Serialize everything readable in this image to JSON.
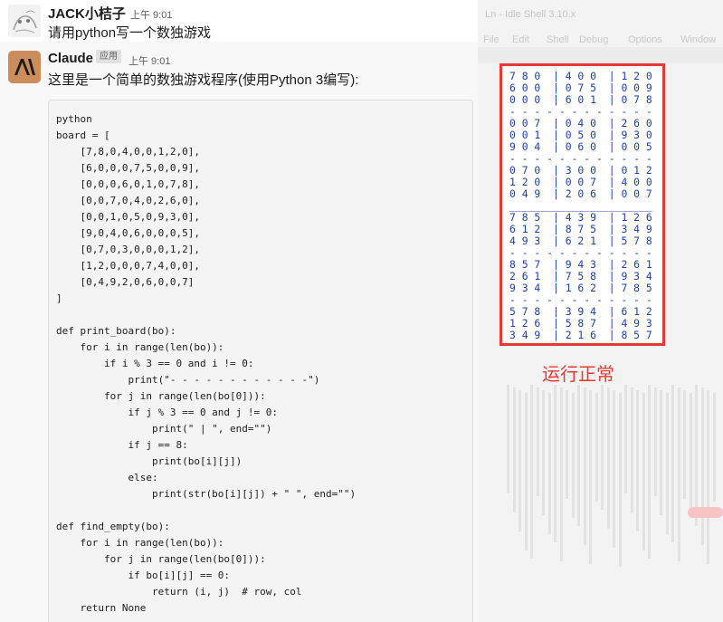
{
  "user_message": {
    "sender": "JACK小桔子",
    "time": "上午 9:01",
    "text": "请用python写一个数独游戏"
  },
  "bot_message": {
    "sender": "Claude",
    "badge": "应用",
    "time": "上午 9:01",
    "intro": "这里是一个简单的数独游戏程序(使用Python 3编写):",
    "code_lines": [
      "python",
      "board = [",
      "    [7,8,0,4,0,0,1,2,0],",
      "    [6,0,0,0,7,5,0,0,9],",
      "    [0,0,0,6,0,1,0,7,8],",
      "    [0,0,7,0,4,0,2,6,0],",
      "    [0,0,1,0,5,0,9,3,0],",
      "    [9,0,4,0,6,0,0,0,5],",
      "    [0,7,0,3,0,0,0,1,2],",
      "    [1,2,0,0,0,7,4,0,0],",
      "    [0,4,9,2,0,6,0,0,7]",
      "]",
      "",
      "def print_board(bo):",
      "    for i in range(len(bo)):",
      "        if i % 3 == 0 and i != 0:",
      "            print(\"- - - - - - - - - - - -\")",
      "        for j in range(len(bo[0])):",
      "            if j % 3 == 0 and j != 0:",
      "                print(\" | \", end=\"\")",
      "            if j == 8:",
      "                print(bo[i][j])",
      "            else:",
      "                print(str(bo[i][j]) + \" \", end=\"\")",
      "",
      "def find_empty(bo):",
      "    for i in range(len(bo)):",
      "        for j in range(len(bo[0])):",
      "            if bo[i][j] == 0:",
      "                return (i, j)  # row, col",
      "    return None"
    ]
  },
  "background_window": {
    "title": "Ln - Idle Shell 3.10.x",
    "menu": [
      "File",
      "Edit",
      "Shell",
      "Debug",
      "Options",
      "Window"
    ]
  },
  "console_output": {
    "rows": [
      "7 8 0  | 4 0 0  | 1 2 0",
      "6 0 0  | 0 7 5  | 0 0 9",
      "0 0 0  | 6 0 1  | 0 7 8",
      "- - - - - - - - - - - -",
      "0 0 7  | 0 4 0  | 2 6 0",
      "0 0 1  | 0 5 0  | 9 3 0",
      "9 0 4  | 0 6 0  | 0 0 5",
      "- - - - - - - - - - - -",
      "0 7 0  | 3 0 0  | 0 1 2",
      "1 2 0  | 0 0 7  | 4 0 0",
      "0 4 9  | 2 0 6  | 0 0 7",
      "_______________________",
      "7 8 5  | 4 3 9  | 1 2 6",
      "6 1 2  | 8 7 5  | 3 4 9",
      "4 9 3  | 6 2 1  | 5 7 8",
      "- - - - - - - - - - - -",
      "8 5 7  | 9 4 3  | 2 6 1",
      "2 6 1  | 7 5 8  | 9 3 4",
      "9 3 4  | 1 6 2  | 7 8 5",
      "- - - - - - - - - - - -",
      "5 7 8  | 3 9 4  | 6 1 2",
      "1 2 6  | 5 8 7  | 4 9 3",
      "3 4 9  | 2 1 6  | 8 5 7"
    ]
  },
  "annotation": "运行正常",
  "colors": {
    "highlight_border": "#e53935",
    "console_text": "#1f3fa8",
    "bot_avatar": "#cc8d5d"
  }
}
